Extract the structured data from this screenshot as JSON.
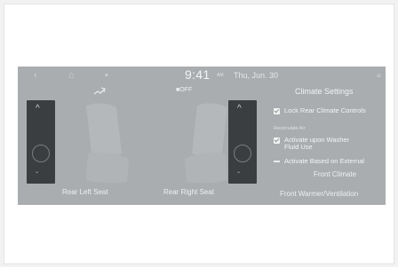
{
  "status_bar": {
    "time": "9:41",
    "ampm": "AM",
    "date": "Thu, Jun. 30"
  },
  "icons": {
    "back": "back-arrow-icon",
    "home": "home-icon",
    "power": "power-icon",
    "fan": "fan-icon",
    "menu": "menu-icon",
    "chevron_up": "chevron-up-icon",
    "chevron_down": "chevron-down-icon"
  },
  "fan_toggle": {
    "label": "OFF"
  },
  "seats": {
    "left_label": "Rear Left Seat",
    "right_label": "Rear Right Seat"
  },
  "climate_settings": {
    "title": "Climate Settings",
    "lock_rear": "Lock Rear Climate Controls",
    "section": "Recirculate Air",
    "washer_line1": "Activate upon Washer",
    "washer_line2": "Fluid Use",
    "external": "Activate Based on External",
    "front_climate": "Front Climate",
    "front_warmer": "Front Warmer/Ventilation"
  },
  "colors": {
    "screen_bg": "#a9adaf",
    "panel_bg": "#3b3e40",
    "text": "#f1f3f3"
  }
}
